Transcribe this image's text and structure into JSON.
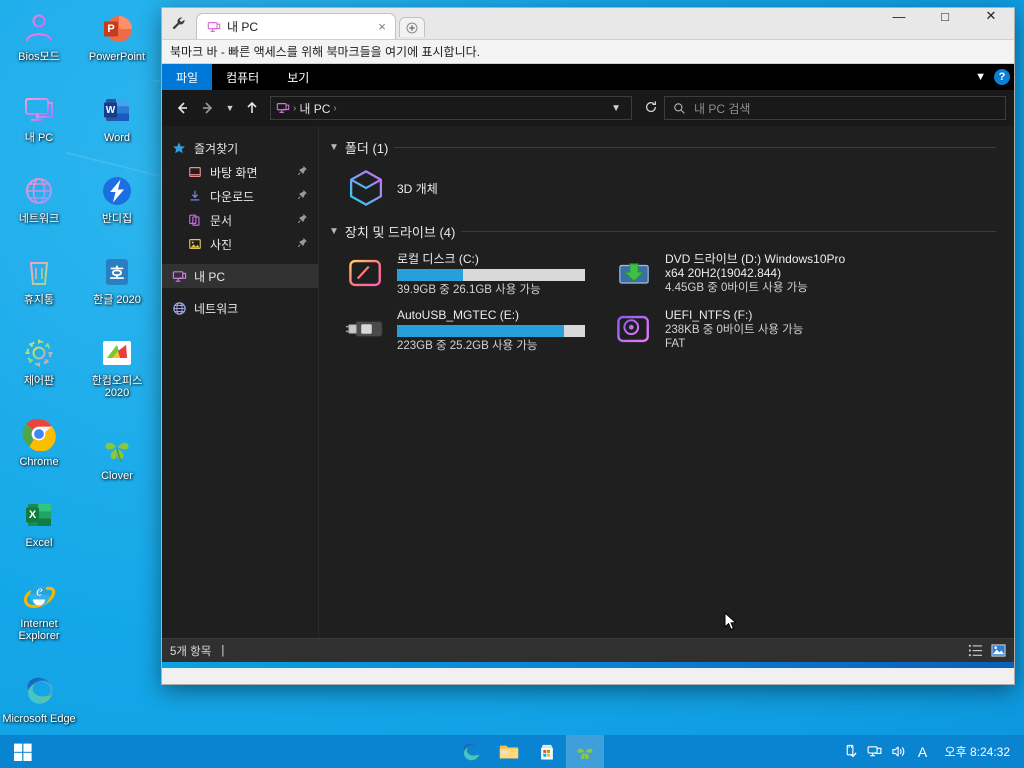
{
  "desktop": {
    "icons": [
      {
        "label": "Bios모드",
        "icon": "person-outline-icon",
        "col": 1
      },
      {
        "label": "내 PC",
        "icon": "monitor-outline-icon",
        "col": 1
      },
      {
        "label": "네트워크",
        "icon": "globe-outline-icon",
        "col": 1
      },
      {
        "label": "휴지통",
        "icon": "recycle-bin-icon",
        "col": 1
      },
      {
        "label": "제어판",
        "icon": "gear-outline-icon",
        "col": 1
      },
      {
        "label": "Chrome",
        "icon": "chrome-icon",
        "col": 1
      },
      {
        "label": "Excel",
        "icon": "excel-icon",
        "col": 1
      },
      {
        "label": "Internet Explorer",
        "icon": "internet-explorer-icon",
        "col": 1
      },
      {
        "label": "Microsoft Edge",
        "icon": "edge-icon",
        "col": 1
      },
      {
        "label": "PowerPoint",
        "icon": "powerpoint-icon",
        "col": 2
      },
      {
        "label": "Word",
        "icon": "word-icon",
        "col": 2
      },
      {
        "label": "반디집",
        "icon": "bandizip-icon",
        "col": 2
      },
      {
        "label": "한글 2020",
        "icon": "hangul-icon",
        "col": 2
      },
      {
        "label": "한컴오피스 2020",
        "icon": "hancom-office-icon",
        "col": 2
      },
      {
        "label": "Clover",
        "icon": "clover-icon",
        "col": 2
      }
    ]
  },
  "window": {
    "tab": {
      "title": "내 PC",
      "icon": "monitor-icon",
      "close_label": "×",
      "new_tab_label": "+",
      "tools_icon": "wrench-icon"
    },
    "controls": {
      "minimize": "—",
      "maximize": "□",
      "close": "✕"
    },
    "bookmark_bar": {
      "text": "북마크 바 - 빠른 액세스를 위해 북마크들을 여기에 표시합니다."
    },
    "ribbon": {
      "tabs": [
        {
          "label": "파일",
          "active": true
        },
        {
          "label": "컴퓨터",
          "active": false
        },
        {
          "label": "보기",
          "active": false
        }
      ],
      "expand_icon": "chevron-down-icon",
      "help_label": "?"
    },
    "address": {
      "back_icon": "arrow-left-icon",
      "forward_icon": "arrow-right-icon",
      "recent_icon": "chevron-down-icon",
      "up_icon": "arrow-up-icon",
      "path_icon": "monitor-icon",
      "crumb": "내 PC",
      "separator": "›",
      "dropdown_icon": "chevron-down-icon",
      "refresh_icon": "refresh-icon"
    },
    "search": {
      "placeholder": "내 PC 검색",
      "icon": "search-icon"
    },
    "nav_pane": {
      "items": [
        {
          "label": "즐겨찾기",
          "icon": "star-icon",
          "level": 0,
          "pinned": false,
          "selected": false
        },
        {
          "label": "바탕 화면",
          "icon": "desktop-icon",
          "level": 1,
          "pinned": true,
          "selected": false
        },
        {
          "label": "다운로드",
          "icon": "downloads-icon",
          "level": 1,
          "pinned": true,
          "selected": false
        },
        {
          "label": "문서",
          "icon": "documents-icon",
          "level": 1,
          "pinned": true,
          "selected": false
        },
        {
          "label": "사진",
          "icon": "pictures-icon",
          "level": 1,
          "pinned": true,
          "selected": false
        },
        {
          "label": "내 PC",
          "icon": "monitor-icon",
          "level": 0,
          "pinned": false,
          "selected": true
        },
        {
          "label": "네트워크",
          "icon": "network-icon",
          "level": 0,
          "pinned": false,
          "selected": false
        }
      ]
    },
    "content": {
      "groups": [
        {
          "title": "폴더 (1)",
          "items": [
            {
              "name": "3D 개체",
              "icon": "3d-objects-icon",
              "type": "folder"
            }
          ]
        },
        {
          "title": "장치 및 드라이브 (4)",
          "items": [
            {
              "name": "로컬 디스크 (C:)",
              "icon": "hard-disk-icon",
              "type": "drive",
              "capacity_text": "39.9GB 중 26.1GB 사용 가능",
              "used_percent": 35
            },
            {
              "name": "DVD 드라이브 (D:) Windows10Pro x64 20H2(19042.844)",
              "icon": "dvd-drive-icon",
              "type": "optical",
              "capacity_text": "4.45GB 중 0바이트 사용 가능",
              "used_percent": 100
            },
            {
              "name": "AutoUSB_MGTEC (E:)",
              "icon": "usb-drive-icon",
              "type": "removable",
              "capacity_text": "223GB 중 25.2GB 사용 가능",
              "used_percent": 89
            },
            {
              "name": "UEFI_NTFS (F:)",
              "icon": "removable-disk-icon",
              "type": "removable",
              "capacity_text": "238KB 중 0바이트 사용 가능",
              "filesystem": "FAT",
              "used_percent": 100
            }
          ]
        }
      ]
    },
    "status_bar": {
      "item_count": "5개 항목",
      "divider": "|",
      "views": [
        {
          "icon": "details-view-icon",
          "active": false
        },
        {
          "icon": "large-icons-view-icon",
          "active": true
        }
      ]
    }
  },
  "taskbar": {
    "start_icon": "windows-start-icon",
    "apps": [
      {
        "icon": "edge-icon",
        "active": false
      },
      {
        "icon": "file-explorer-icon",
        "active": false
      },
      {
        "icon": "microsoft-store-icon",
        "active": false
      },
      {
        "icon": "clover-icon",
        "active": true
      }
    ],
    "tray": [
      {
        "icon": "usb-eject-icon"
      },
      {
        "icon": "network-icon"
      },
      {
        "icon": "volume-icon"
      },
      {
        "icon": "ime-a-icon",
        "label": "A"
      }
    ],
    "clock": "오후 8:24:32"
  },
  "colors": {
    "accent": "#0078d7",
    "wallpaper": "#14a7e8",
    "progress_blue": "#26a0da",
    "window_dark": "#1f1f1f",
    "taskbar": "#0a84d0"
  }
}
